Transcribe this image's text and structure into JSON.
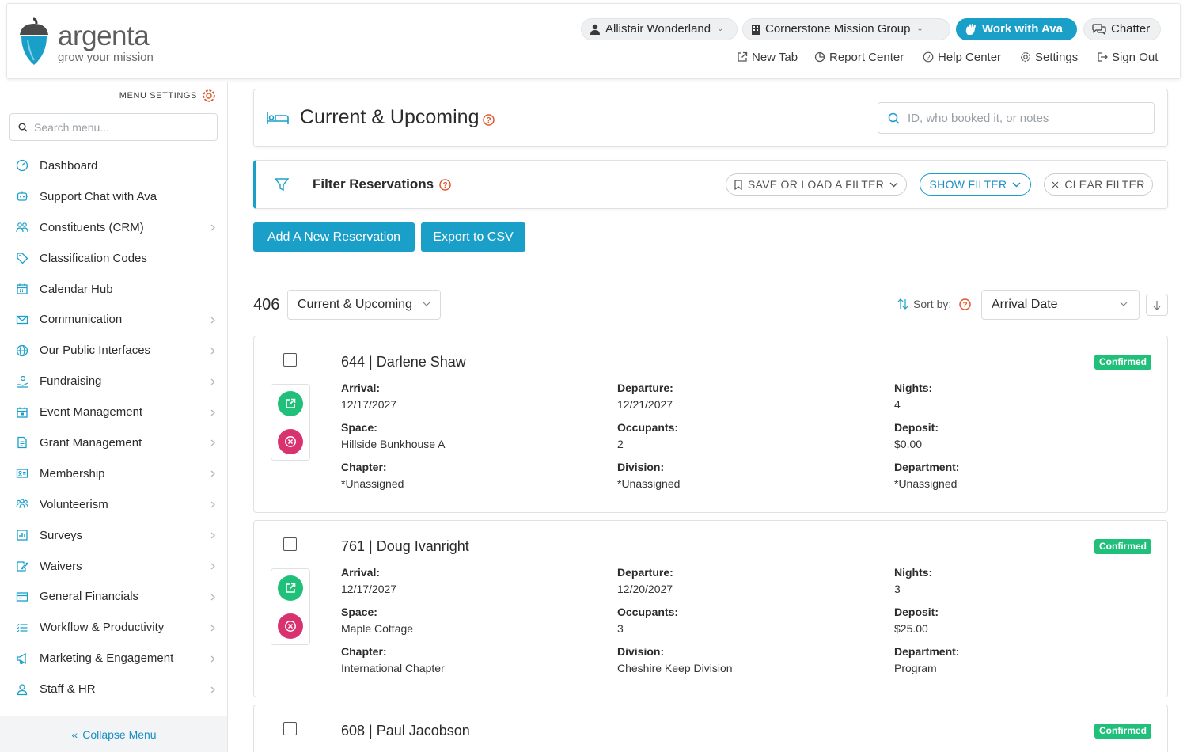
{
  "brand": {
    "name": "argenta",
    "tagline": "grow your mission",
    "color": "#1a9fc9"
  },
  "header": {
    "user": "Allistair Wonderland",
    "org": "Cornerstone Mission Group",
    "ava_button": "Work with Ava",
    "chatter": "Chatter",
    "links": {
      "new_tab": "New Tab",
      "report_center": "Report Center",
      "help_center": "Help Center",
      "settings": "Settings",
      "sign_out": "Sign Out"
    }
  },
  "sidebar": {
    "menu_settings": "MENU SETTINGS",
    "search_placeholder": "Search menu...",
    "items": [
      {
        "label": "Dashboard",
        "icon": "dashboard-icon",
        "expandable": false
      },
      {
        "label": "Support Chat with Ava",
        "icon": "robot-icon",
        "expandable": false
      },
      {
        "label": "Constituents (CRM)",
        "icon": "people-icon",
        "expandable": true
      },
      {
        "label": "Classification Codes",
        "icon": "tag-icon",
        "expandable": false
      },
      {
        "label": "Calendar Hub",
        "icon": "calendar-icon",
        "expandable": false
      },
      {
        "label": "Communication",
        "icon": "envelope-icon",
        "expandable": true
      },
      {
        "label": "Our Public Interfaces",
        "icon": "globe-icon",
        "expandable": true
      },
      {
        "label": "Fundraising",
        "icon": "hand-coin-icon",
        "expandable": true
      },
      {
        "label": "Event Management",
        "icon": "event-icon",
        "expandable": true
      },
      {
        "label": "Grant Management",
        "icon": "document-icon",
        "expandable": true
      },
      {
        "label": "Membership",
        "icon": "id-card-icon",
        "expandable": true
      },
      {
        "label": "Volunteerism",
        "icon": "group-icon",
        "expandable": true
      },
      {
        "label": "Surveys",
        "icon": "bar-chart-icon",
        "expandable": true
      },
      {
        "label": "Waivers",
        "icon": "signature-icon",
        "expandable": true
      },
      {
        "label": "General Financials",
        "icon": "ledger-icon",
        "expandable": true
      },
      {
        "label": "Workflow & Productivity",
        "icon": "list-icon",
        "expandable": true
      },
      {
        "label": "Marketing & Engagement",
        "icon": "megaphone-icon",
        "expandable": true
      },
      {
        "label": "Staff & HR",
        "icon": "person-icon",
        "expandable": true
      }
    ],
    "collapse": "Collapse Menu"
  },
  "page": {
    "title": "Current & Upcoming",
    "search_placeholder": "ID, who booked it, or notes",
    "filter_title": "Filter Reservations",
    "save_filter": "SAVE OR LOAD A FILTER",
    "show_filter": "SHOW FILTER",
    "clear_filter": "CLEAR FILTER",
    "add_button": "Add A New Reservation",
    "export_button": "Export to CSV",
    "count": "406",
    "scope": "Current & Upcoming",
    "sort_label": "Sort by:",
    "sort_value": "Arrival Date"
  },
  "labels": {
    "arrival": "Arrival:",
    "departure": "Departure:",
    "nights": "Nights:",
    "space": "Space:",
    "occupants": "Occupants:",
    "deposit": "Deposit:",
    "chapter": "Chapter:",
    "division": "Division:",
    "department": "Department:"
  },
  "reservations": [
    {
      "title": "644 | Darlene Shaw",
      "status": "Confirmed",
      "arrival": "12/17/2027",
      "departure": "12/21/2027",
      "nights": "4",
      "space": "Hillside Bunkhouse A",
      "occupants": "2",
      "deposit": "$0.00",
      "chapter": "*Unassigned",
      "division": "*Unassigned",
      "department": "*Unassigned"
    },
    {
      "title": "761 | Doug Ivanright",
      "status": "Confirmed",
      "arrival": "12/17/2027",
      "departure": "12/20/2027",
      "nights": "3",
      "space": "Maple Cottage",
      "occupants": "3",
      "deposit": "$25.00",
      "chapter": "International Chapter",
      "division": "Cheshire Keep Division",
      "department": "Program"
    },
    {
      "title": "608 | Paul Jacobson",
      "status": "Confirmed"
    }
  ]
}
